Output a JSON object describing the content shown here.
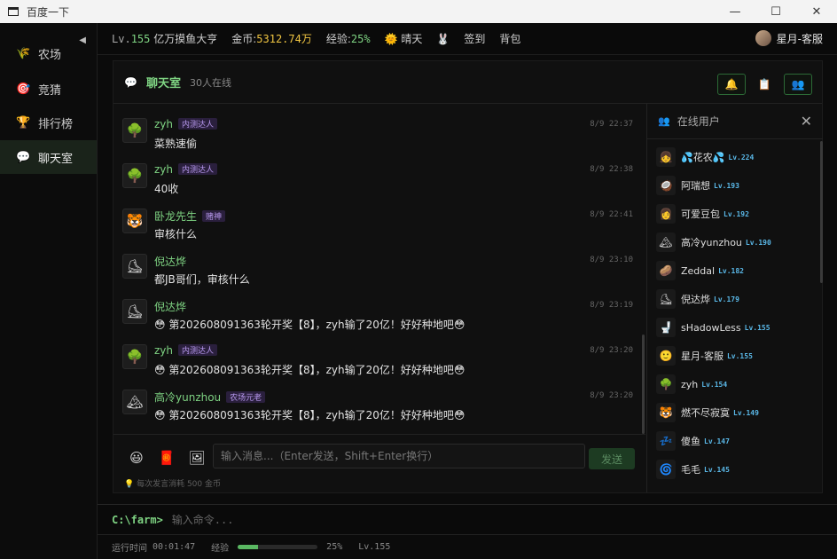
{
  "window": {
    "title": "百度一下",
    "controls": [
      "—",
      "☐",
      "✕"
    ]
  },
  "sidebar": {
    "collapse_glyph": "◀",
    "items": [
      {
        "icon": "🌾",
        "label": "农场",
        "active": false
      },
      {
        "icon": "🎯",
        "label": "竞猜",
        "active": false
      },
      {
        "icon": "🏆",
        "label": "排行榜",
        "active": false
      },
      {
        "icon": "💬",
        "label": "聊天室",
        "active": true
      }
    ]
  },
  "stats": {
    "level_prefix": "Lv.",
    "level": "155",
    "title": "亿万摸鱼大亨",
    "coins_label": "金币:",
    "coins": "5312.74万",
    "exp_label": "经验:",
    "exp": "25%",
    "weather_icon": "🌞",
    "weather": "晴天",
    "pet_icon": "🐰",
    "checkin": "签到",
    "bag": "背包",
    "username": "星月-客服"
  },
  "chat": {
    "icon": "💬",
    "title": "聊天室",
    "online_count": "30人在线",
    "header_buttons": [
      "🔔",
      "📋",
      "👥"
    ],
    "messages": [
      {
        "avatar": "🌳",
        "name": "zyh",
        "badge": "内测达人",
        "time": "8/9 22:37",
        "text": "菜熟速偷"
      },
      {
        "avatar": "🌳",
        "name": "zyh",
        "badge": "内测达人",
        "time": "8/9 22:38",
        "text": "40收"
      },
      {
        "avatar": "🐯",
        "name": "卧龙先生",
        "badge": "赌神",
        "time": "8/9 22:41",
        "text": "审核什么"
      },
      {
        "avatar": "⛸",
        "name": "倪达烨",
        "badge": "",
        "time": "8/9 23:10",
        "text": "都JB哥们，审核什么"
      },
      {
        "avatar": "⛸",
        "name": "倪达烨",
        "badge": "",
        "time": "8/9 23:19",
        "text": "😳 第202608091363轮开奖【8】，zyh输了20亿！好好种地吧😳"
      },
      {
        "avatar": "🌳",
        "name": "zyh",
        "badge": "内测达人",
        "time": "8/9 23:20",
        "text": "😳 第202608091363轮开奖【8】，zyh输了20亿！好好种地吧😳"
      },
      {
        "avatar": "🏔",
        "name": "高冷yunzhou",
        "badge": "农场元老",
        "time": "8/9 23:20",
        "text": "😳 第202608091363轮开奖【8】，zyh输了20亿！好好种地吧😳"
      }
    ],
    "tools": [
      "😃",
      "🧧",
      "🖼"
    ],
    "input_placeholder": "输入消息...（Enter发送，Shift+Enter换行）",
    "send_label": "发送",
    "tip_icon": "💡",
    "tip": "每次发言消耗 500 金币"
  },
  "online_users": {
    "icon": "👥",
    "title": "在线用户",
    "close": "✕",
    "users": [
      {
        "avatar": "👧",
        "name": "💦花农💦",
        "level": "Lv.224"
      },
      {
        "avatar": "🥥",
        "name": "阿瑞想",
        "level": "Lv.193"
      },
      {
        "avatar": "👩",
        "name": "可爱豆包",
        "level": "Lv.192"
      },
      {
        "avatar": "🏔",
        "name": "高冷yunzhou",
        "level": "Lv.190"
      },
      {
        "avatar": "🥔",
        "name": "Zeddal",
        "level": "Lv.182"
      },
      {
        "avatar": "⛸",
        "name": "倪达烨",
        "level": "Lv.179"
      },
      {
        "avatar": "🚽",
        "name": "sHadowLess",
        "level": "Lv.155"
      },
      {
        "avatar": "🙂",
        "name": "星月-客服",
        "level": "Lv.155"
      },
      {
        "avatar": "🌳",
        "name": "zyh",
        "level": "Lv.154"
      },
      {
        "avatar": "🐯",
        "name": "燃不尽寂寞",
        "level": "Lv.149"
      },
      {
        "avatar": "💤",
        "name": "傻鱼",
        "level": "Lv.147"
      },
      {
        "avatar": "🌀",
        "name": "毛毛",
        "level": "Lv.145"
      }
    ]
  },
  "command": {
    "prompt": "C:\\farm>",
    "placeholder": "输入命令..."
  },
  "status": {
    "runtime_label": "运行时间",
    "runtime": "00:01:47",
    "exp_label": "经验",
    "exp_fraction": 0.25,
    "exp_percent": "25%",
    "level": "Lv.155"
  }
}
